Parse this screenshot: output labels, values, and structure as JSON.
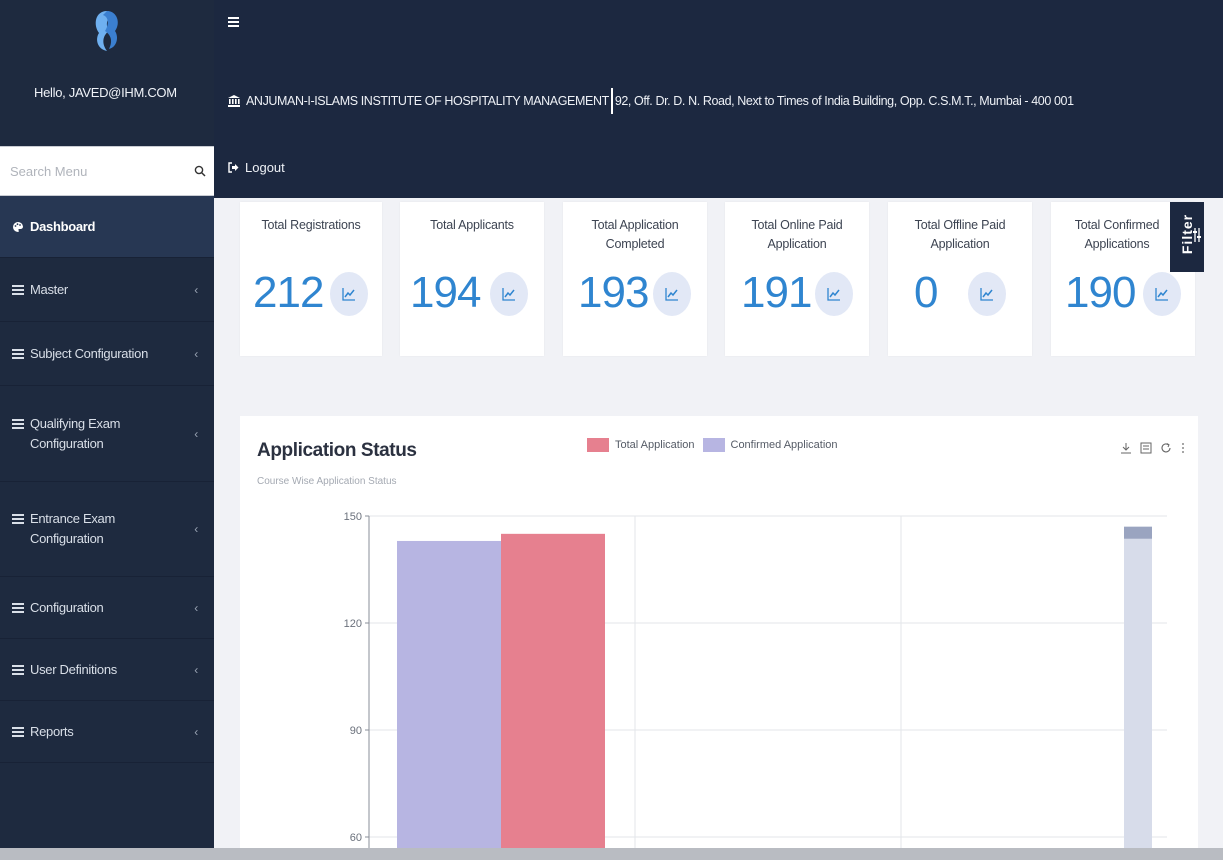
{
  "sidebar": {
    "greeting": "Hello, JAVED@IHM.COM",
    "search": {
      "placeholder": "Search Menu"
    },
    "items": [
      {
        "label": "Dashboard",
        "icon": "palette-icon",
        "active": true
      },
      {
        "label": "Master",
        "icon": "list-icon"
      },
      {
        "label": "Subject Configuration",
        "icon": "list-icon"
      },
      {
        "label": "Qualifying Exam Configuration",
        "icon": "list-icon"
      },
      {
        "label": "Entrance Exam Configuration",
        "icon": "list-icon"
      },
      {
        "label": "Configuration",
        "icon": "list-icon"
      },
      {
        "label": "User Definitions",
        "icon": "list-icon"
      },
      {
        "label": "Reports",
        "icon": "list-icon"
      }
    ]
  },
  "header": {
    "institute_name": "ANJUMAN-I-ISLAMS INSTITUTE OF HOSPITALITY MANAGEMENT",
    "institute_address": "92, Off. Dr. D. N. Road, Next to Times of India Building, Opp. C.S.M.T., Mumbai - 400 001",
    "logout_label": "Logout"
  },
  "stats": [
    {
      "title": "Total Registrations",
      "value": "212"
    },
    {
      "title": "Total Applicants",
      "value": "194"
    },
    {
      "title": "Total Application Completed",
      "value": "193"
    },
    {
      "title": "Total Online Paid Application",
      "value": "191"
    },
    {
      "title": "Total Offline Paid Application",
      "value": "0"
    },
    {
      "title": "Total Confirmed Applications",
      "value": "190"
    }
  ],
  "filter": {
    "label": "Filter"
  },
  "chart_panel": {
    "title": "Application Status",
    "subtitle": "Course Wise Application Status"
  },
  "colors": {
    "sidebar_bg": "#1e2a3f",
    "header_bg": "#1c2840",
    "stat_value": "#2f85d0",
    "total_application": "#e6808f",
    "confirmed_application": "#b7b5e2"
  },
  "chart_data": {
    "type": "bar",
    "title": "Application Status",
    "subtitle": "Course Wise Application Status",
    "ylim": [
      60,
      150
    ],
    "yticks": [
      60,
      90,
      120,
      150
    ],
    "grid": true,
    "legend_position": "top",
    "categories": [
      "",
      "",
      ""
    ],
    "series": [
      {
        "name": "Confirmed Application",
        "color": "#b7b5e2",
        "values": [
          143,
          null,
          147
        ]
      },
      {
        "name": "Total Application",
        "color": "#e6808f",
        "values": [
          145,
          null,
          null
        ]
      }
    ]
  }
}
